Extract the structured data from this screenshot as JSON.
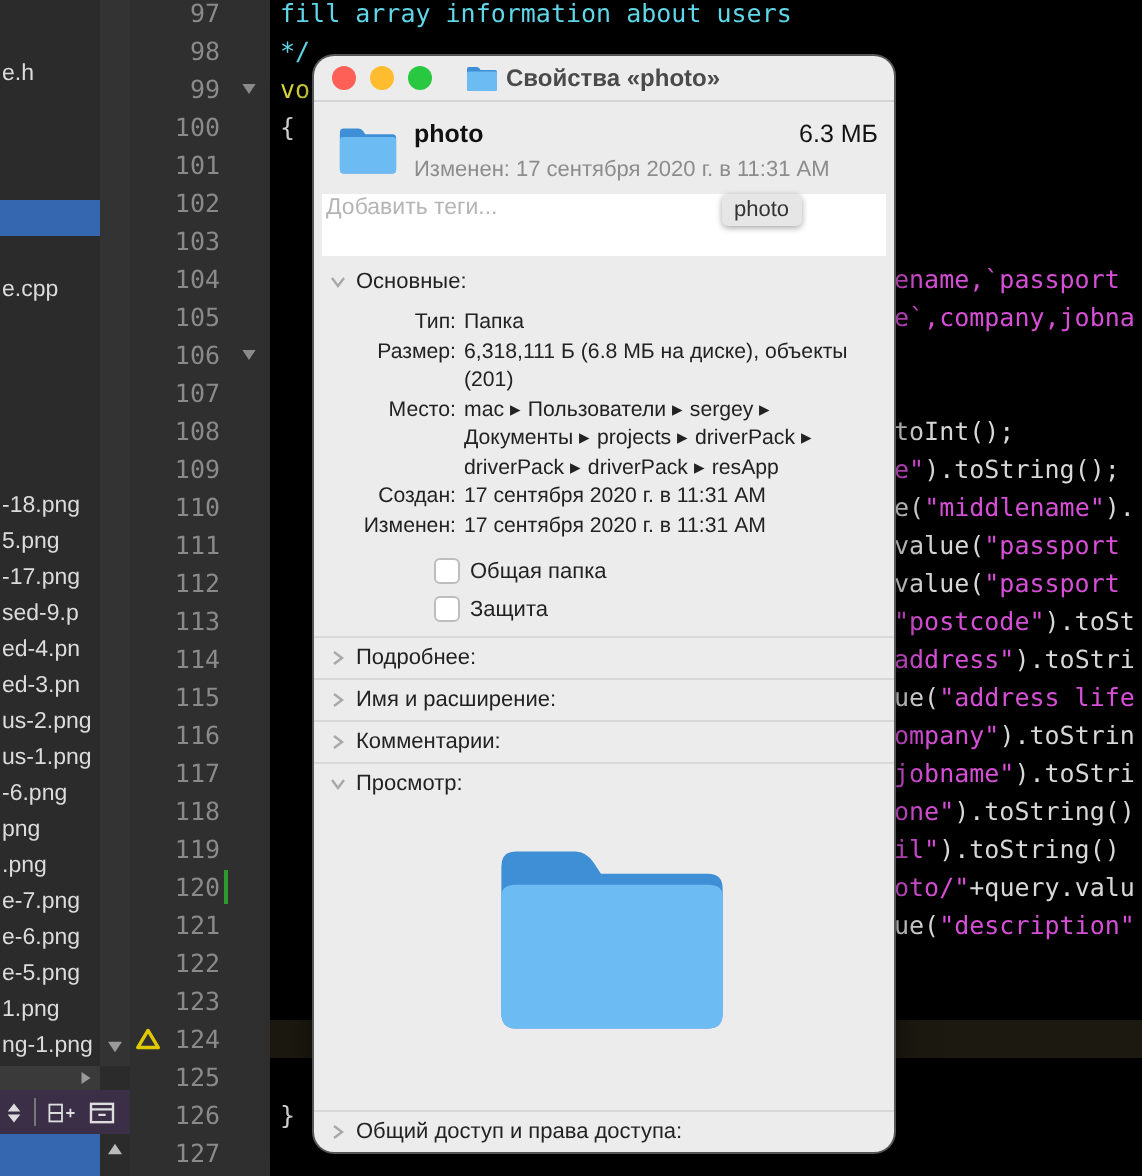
{
  "sidebar": {
    "rows": [
      {
        "text": "e.h",
        "selected": false
      },
      {
        "selected": false
      },
      {
        "selected": false
      },
      {
        "selected": false
      },
      {
        "selected": true
      },
      {
        "selected": false
      },
      {
        "text": "e.cpp",
        "selected": false
      },
      {
        "selected": false
      },
      {
        "selected": false
      },
      {
        "selected": false
      },
      {
        "selected": false
      },
      {
        "selected": false
      },
      {
        "text": "-18.png",
        "selected": false
      },
      {
        "text": "5.png",
        "selected": false
      },
      {
        "text": "-17.png",
        "selected": false
      },
      {
        "text": "sed-9.p",
        "selected": false
      },
      {
        "text": "ed-4.pn",
        "selected": false
      },
      {
        "text": "ed-3.pn",
        "selected": false
      },
      {
        "text": "us-2.png",
        "selected": false
      },
      {
        "text": "us-1.png",
        "selected": false
      },
      {
        "text": "-6.png",
        "selected": false
      },
      {
        "text": "png",
        "selected": false
      },
      {
        "text": ".png",
        "selected": false
      },
      {
        "text": "e-7.png",
        "selected": false
      },
      {
        "text": "e-6.png",
        "selected": false
      },
      {
        "text": "e-5.png",
        "selected": false
      },
      {
        "text": "1.png",
        "selected": false
      },
      {
        "text": "ng-1.png",
        "selected": false
      }
    ]
  },
  "code": {
    "lines": [
      {
        "n": "97",
        "highlighted": false,
        "left": [
          {
            "kind": "comment",
            "text": "fill array information about users"
          }
        ]
      },
      {
        "n": "98",
        "highlighted": false,
        "left": [
          {
            "kind": "comment",
            "text": "*/"
          }
        ]
      },
      {
        "n": "99",
        "fold": true,
        "highlighted": false,
        "left": [
          {
            "kind": "keyword",
            "text": "vo"
          }
        ]
      },
      {
        "n": "100",
        "highlighted": false,
        "left": [
          {
            "kind": "plain",
            "text": "{"
          }
        ]
      },
      {
        "n": "101",
        "highlighted": false
      },
      {
        "n": "102",
        "highlighted": false
      },
      {
        "n": "103",
        "highlighted": false
      },
      {
        "n": "104",
        "highlighted": false,
        "right": [
          {
            "kind": "string",
            "text": "ename,`passport"
          }
        ]
      },
      {
        "n": "105",
        "highlighted": false,
        "right": [
          {
            "kind": "string",
            "text": "e`,company,jobna"
          }
        ]
      },
      {
        "n": "106",
        "fold": true,
        "highlighted": false
      },
      {
        "n": "107",
        "highlighted": false
      },
      {
        "n": "108",
        "highlighted": false,
        "right": [
          {
            "kind": "plain",
            "text": "toInt();"
          }
        ]
      },
      {
        "n": "109",
        "highlighted": false,
        "right": [
          {
            "kind": "string",
            "text": "e\""
          },
          {
            "kind": "plain",
            "text": ").toString();"
          }
        ]
      },
      {
        "n": "110",
        "highlighted": false,
        "right": [
          {
            "kind": "plain",
            "text": "e("
          },
          {
            "kind": "string",
            "text": "\"middlename\""
          },
          {
            "kind": "plain",
            "text": ")."
          }
        ]
      },
      {
        "n": "111",
        "highlighted": false,
        "right": [
          {
            "kind": "plain",
            "text": "value("
          },
          {
            "kind": "string",
            "text": "\"passport"
          }
        ]
      },
      {
        "n": "112",
        "highlighted": false,
        "right": [
          {
            "kind": "plain",
            "text": "value("
          },
          {
            "kind": "string",
            "text": "\"passport"
          }
        ]
      },
      {
        "n": "113",
        "highlighted": false,
        "right": [
          {
            "kind": "string",
            "text": "\"postcode\""
          },
          {
            "kind": "plain",
            "text": ").toSt"
          }
        ]
      },
      {
        "n": "114",
        "highlighted": false,
        "right": [
          {
            "kind": "string",
            "text": "address\""
          },
          {
            "kind": "plain",
            "text": ").toStri"
          }
        ]
      },
      {
        "n": "115",
        "highlighted": false,
        "right": [
          {
            "kind": "plain",
            "text": "ue("
          },
          {
            "kind": "string",
            "text": "\"address life"
          }
        ]
      },
      {
        "n": "116",
        "highlighted": false,
        "right": [
          {
            "kind": "string",
            "text": "ompany\""
          },
          {
            "kind": "plain",
            "text": ").toStrin"
          }
        ]
      },
      {
        "n": "117",
        "highlighted": false,
        "right": [
          {
            "kind": "string",
            "text": "jobname\""
          },
          {
            "kind": "plain",
            "text": ").toStri"
          }
        ]
      },
      {
        "n": "118",
        "highlighted": false,
        "right": [
          {
            "kind": "string",
            "text": "one\""
          },
          {
            "kind": "plain",
            "text": ").toString()"
          }
        ]
      },
      {
        "n": "119",
        "highlighted": false,
        "right": [
          {
            "kind": "string",
            "text": "il\""
          },
          {
            "kind": "plain",
            "text": ").toString()"
          }
        ]
      },
      {
        "n": "120",
        "kind": "change",
        "highlighted": false,
        "right": [
          {
            "kind": "string",
            "text": "oto/\""
          },
          {
            "kind": "plain",
            "text": "+query.valu"
          }
        ]
      },
      {
        "n": "121",
        "highlighted": false,
        "right": [
          {
            "kind": "plain",
            "text": "ue("
          },
          {
            "kind": "string",
            "text": "\"description\""
          }
        ]
      },
      {
        "n": "122",
        "highlighted": false
      },
      {
        "n": "123",
        "highlighted": false
      },
      {
        "n": "124",
        "kind": "warning",
        "highlighted": true
      },
      {
        "n": "125",
        "highlighted": false
      },
      {
        "n": "126",
        "highlighted": false,
        "left": [
          {
            "kind": "plain",
            "text": "}"
          }
        ]
      },
      {
        "n": "127",
        "highlighted": false
      }
    ]
  },
  "dialog": {
    "title": "Свойства «photo»",
    "name": "photo",
    "size": "6.3 МБ",
    "modified": "Изменен: 17 сентября 2020 г. в 11:31 AM",
    "tooltip": "photo",
    "tags": {
      "placeholder": "Добавить теги..."
    },
    "sections": [
      {
        "kind": "general",
        "label": "Основные:",
        "expanded": true,
        "fields": [
          {
            "label": "Тип:",
            "value": "Папка"
          },
          {
            "label": "Размер:",
            "value": "6,318,111 Б (6.8 МБ на диске), объекты (201)"
          },
          {
            "label": "Место:",
            "value": "mac ▸ Пользователи ▸ sergey ▸ Документы ▸ projects ▸ driverPack ▸ driverPack ▸ driverPack ▸ resApp"
          },
          {
            "label": "Создан:",
            "value": "17 сентября 2020 г. в 11:31 AM"
          },
          {
            "label": "Изменен:",
            "value": "17 сентября 2020 г. в 11:31 AM"
          }
        ],
        "checkboxes": [
          {
            "label": "Общая папка",
            "checked": false
          },
          {
            "label": "Защита",
            "checked": false
          }
        ]
      },
      {
        "kind": "plain",
        "label": "Подробнее:",
        "expanded": false
      },
      {
        "kind": "plain",
        "label": "Имя и расширение:",
        "expanded": false
      },
      {
        "kind": "plain",
        "label": "Комментарии:",
        "expanded": false
      },
      {
        "kind": "preview",
        "label": "Просмотр:",
        "expanded": true
      },
      {
        "kind": "plain",
        "label": "Общий доступ и права доступа:",
        "expanded": false
      }
    ]
  }
}
